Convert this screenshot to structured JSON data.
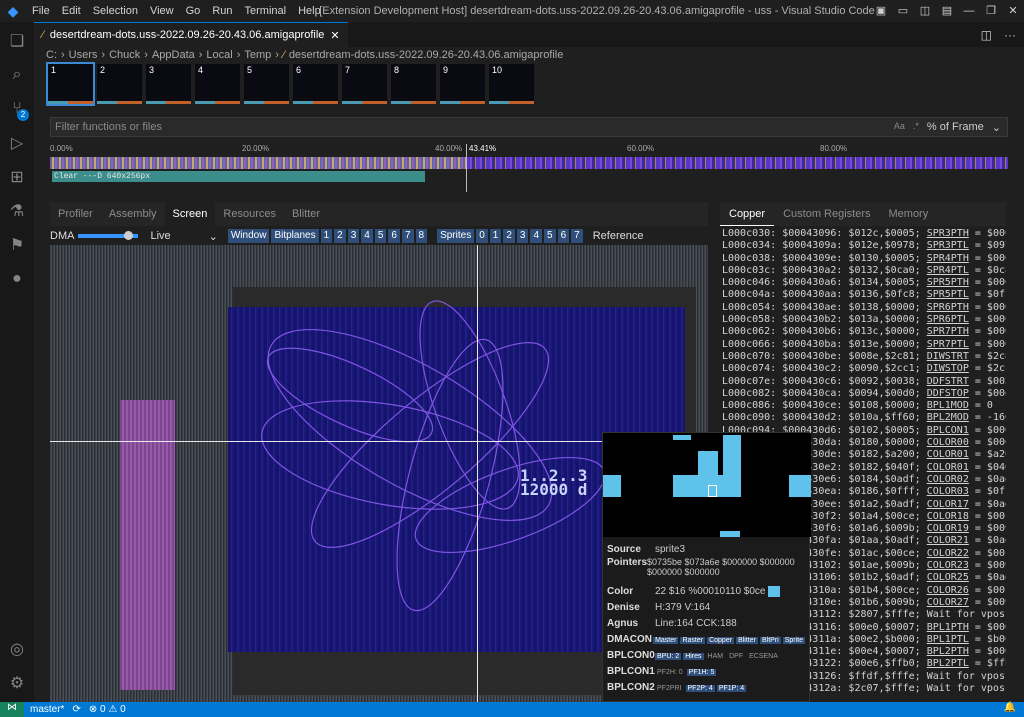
{
  "window": {
    "title": "[Extension Development Host] desertdream-dots.uss-2022.09.26-20.43.06.amigaprofile - uss - Visual Studio Code"
  },
  "menu": [
    "File",
    "Edit",
    "Selection",
    "View",
    "Go",
    "Run",
    "Terminal",
    "Help"
  ],
  "tab": {
    "label": "desertdream-dots.uss-2022.09.26-20.43.06.amigaprofile",
    "close": "✕"
  },
  "breadcrumb": [
    "C:",
    "Users",
    "Chuck",
    "AppData",
    "Local",
    "Temp",
    "desertdream-dots.uss-2022.09.26-20.43.06.amigaprofile"
  ],
  "frames": [
    "1",
    "2",
    "3",
    "4",
    "5",
    "6",
    "7",
    "8",
    "9",
    "10"
  ],
  "filter": {
    "placeholder": "Filter functions or files",
    "aa": "Aa",
    "regex": ".*",
    "mode": "% of Frame"
  },
  "timeline": {
    "ticks": [
      "0.00%",
      "20.00%",
      "40.00%",
      "60.00%",
      "80.00%"
    ],
    "cursor": "43.41%",
    "cursor_pct": 43.41,
    "bar": "Clear ---D 640x256px"
  },
  "left_tabs": [
    "Profiler",
    "Assembly",
    "Screen",
    "Resources",
    "Blitter"
  ],
  "toolbar": {
    "dma": "DMA",
    "live": "Live",
    "window": "Window",
    "bitplanes": "Bitplanes",
    "bp": [
      "1",
      "2",
      "3",
      "4",
      "5",
      "6",
      "7",
      "8"
    ],
    "sprites": "Sprites",
    "sp": [
      "0",
      "1",
      "2",
      "3",
      "4",
      "5",
      "6",
      "7"
    ],
    "reference": "Reference"
  },
  "screen_text": "1..2..3\n12000 d",
  "right_tabs": [
    "Copper",
    "Custom Registers",
    "Memory"
  ],
  "copper": [
    [
      "L000c030: $00043096: $012c,$0005; ",
      "SPR3PTH",
      " = $0005"
    ],
    [
      "L000c034: $0004309a: $012e,$0978; ",
      "SPR3PTL",
      " = $0978"
    ],
    [
      "L000c038: $0004309e: $0130,$0005; ",
      "SPR4PTH",
      " = $0005"
    ],
    [
      "L000c03c: $000430a2: $0132,$0ca0; ",
      "SPR4PTL",
      " = $0ca0"
    ],
    [
      "L000c046: $000430a6: $0134,$0005; ",
      "SPR5PTH",
      " = $0005"
    ],
    [
      "L000c04a: $000430aa: $0136,$0fc8; ",
      "SPR5PTL",
      " = $0fc8"
    ],
    [
      "L000c054: $000430ae: $0138,$0000; ",
      "SPR6PTH",
      " = $0000"
    ],
    [
      "L000c058: $000430b2: $013a,$0000; ",
      "SPR6PTL",
      " = $0000"
    ],
    [
      "L000c062: $000430b6: $013c,$0000; ",
      "SPR7PTH",
      " = $0000"
    ],
    [
      "L000c066: $000430ba: $013e,$0000; ",
      "SPR7PTL",
      " = $0000"
    ],
    [
      "L000c070: $000430be: $008e,$2c81; ",
      "DIWSTRT",
      " = $2c81"
    ],
    [
      "L000c074: $000430c2: $0090,$2cc1; ",
      "DIWSTOP",
      " = $2cc1"
    ],
    [
      "L000c07e: $000430c6: $0092,$0038; ",
      "DDFSTRT",
      " = $0038"
    ],
    [
      "L000c082: $000430ca: $0094,$00d0; ",
      "DDFSTOP",
      " = $00d0"
    ],
    [
      "L000c086: $000430ce: $0108,$0000; ",
      "BPL1MOD",
      " = 0"
    ],
    [
      "L000c090: $000430d2: $010a,$ff60; ",
      "BPL2MOD",
      " = -160"
    ],
    [
      "L000c094: $000430d6: $0102,$0005; ",
      "BPLCON1",
      " = $0005"
    ],
    [
      "L000c09e: $000430da: $0180,$0000; ",
      "COLOR00",
      " = $0000"
    ],
    [
      "L000c0a2: $000430de: $0182,$a200; ",
      "COLOR01",
      " = $a200"
    ],
    [
      "L000c0ac: $000430e2: $0182,$040f; ",
      "COLOR01",
      " = $040f"
    ],
    [
      "L000c0b0: $000430e6: $0184,$0adf; ",
      "COLOR02",
      " = $0adf"
    ],
    [
      "L000c0ba: $000430ea: $0186,$0fff; ",
      "COLOR03",
      " = $0fff"
    ],
    [
      "L000c0be: $000430ee: $01a2,$0adf; ",
      "COLOR17",
      " = $0adf"
    ],
    [
      "L000c0c8: $000430f2: $01a4,$00ce; ",
      "COLOR18",
      " = $00ce"
    ],
    [
      "L000c0cc: $000430f6: $01a6,$009b; ",
      "COLOR19",
      " = $009b"
    ],
    [
      "L000c0d6: $000430fa: $01aa,$0adf; ",
      "COLOR21",
      " = $0adf"
    ],
    [
      "L000c0da: $000430fe: $01ac,$00ce; ",
      "COLOR22",
      " = $00ce"
    ],
    [
      "L000c0e4: $00043102: $01ae,$009b; ",
      "COLOR23",
      " = $009b"
    ],
    [
      "L000c0e8: $00043106: $01b2,$0adf; ",
      "COLOR25",
      " = $0adf"
    ],
    [
      "L000c0f2: $0004310a: $01b4,$00ce; ",
      "COLOR26",
      " = $00ce"
    ],
    [
      "L000c0f6: $0004310e: $01b6,$009b; ",
      "COLOR27",
      " = $009b"
    ],
    [
      "L000c100: $00043112: $2807,$fffe; ",
      "",
      "Wait for vpos >="
    ],
    [
      "L000c104: $00043116: $00e0,$0007; ",
      "BPL1PTH",
      " = $0007"
    ],
    [
      "L000c10e: $0004311a: $00e2,$b000; ",
      "BPL1PTL",
      " = $b000"
    ],
    [
      "L000c112: $0004311e: $00e4,$0007; ",
      "BPL2PTH",
      " = $0007"
    ],
    [
      "L000c11c: $00043122: $00e6,$ffb0; ",
      "BPL2PTL",
      " = $ffb0"
    ],
    [
      "L000c120: $00043126: $ffdf,$fffe; ",
      "",
      "Wait for vpos >="
    ],
    [
      "L000c12a: $0004312a: $2c07,$fffe; ",
      "",
      "Wait for vpos >="
    ]
  ],
  "popup": {
    "source_label": "Source",
    "source": "sprite3",
    "pointers_label": "Pointers",
    "pointers": "$0735be $073a6e $000000 $000000 $000000 $000000",
    "color_label": "Color",
    "color": "22 $16 %00010110 $0ce",
    "color_hex": "#5ec2ea",
    "denise_label": "Denise",
    "denise": "H:379 V:164",
    "agnus_label": "Agnus",
    "agnus": "Line:164 CCK:188",
    "dmacon_label": "DMACON",
    "dmacon": [
      "Master",
      "Raster",
      "Copper",
      "Blitter",
      "BltPri",
      "Sprite"
    ],
    "bplcon0_label": "BPLCON0",
    "bplcon0": [
      "BPU: 2",
      "Hires",
      "HAM",
      "DPF",
      "ECSENA"
    ],
    "bplcon1_label": "BPLCON1",
    "bplcon1": [
      "PF2H: 0",
      "PF1H: 5"
    ],
    "bplcon2_label": "BPLCON2",
    "bplcon2": [
      "PF2PRI",
      "PF2P: 4",
      "PF1P: 4"
    ]
  },
  "status": {
    "branch": "master*",
    "sync": "⟳",
    "problems": "⊗ 0 ⚠ 0",
    "bell": "🔔"
  }
}
